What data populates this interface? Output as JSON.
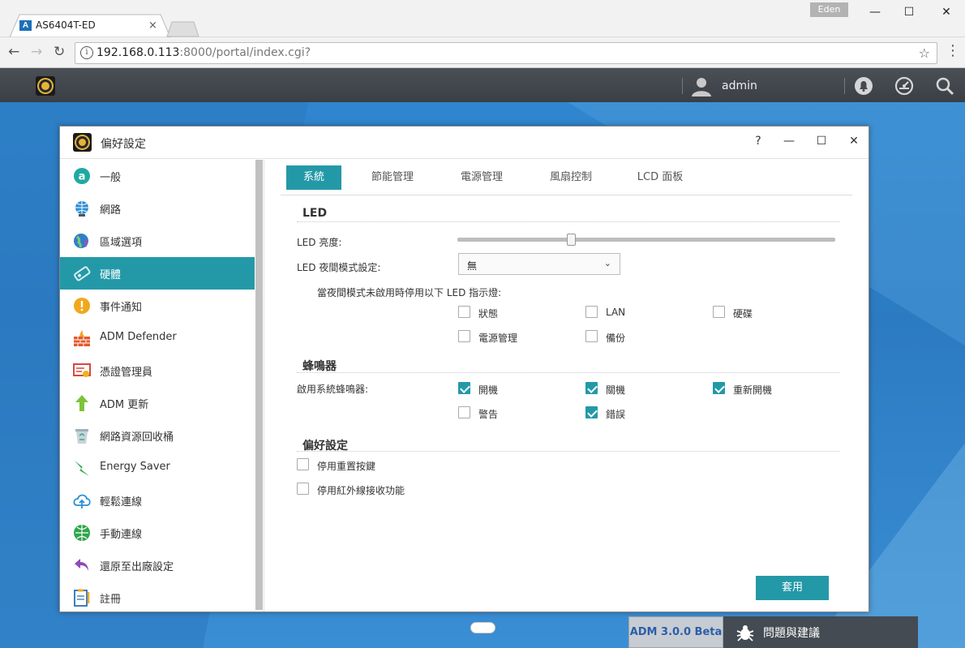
{
  "browser": {
    "tab_title": "AS6404T-ED",
    "tab_favicon": "A",
    "tab_close": "×",
    "profile_name": "Eden",
    "url_host": "192.168.0.113",
    "url_path": ":8000/portal/index.cgi?",
    "info_glyph": "i",
    "back_glyph": "←",
    "forward_glyph": "→",
    "reload_glyph": "↻",
    "star_glyph": "☆",
    "menu_glyph": "⋮",
    "minimize_glyph": "—",
    "maximize_glyph": "☐",
    "close_glyph": "✕"
  },
  "adm": {
    "username": "admin",
    "version": "ADM 3.0.0 Beta",
    "feedback_label": "問題與建議"
  },
  "dialog": {
    "title": "偏好設定",
    "help_glyph": "?",
    "minimize_glyph": "—",
    "maximize_glyph": "☐",
    "close_glyph": "✕"
  },
  "sidebar": {
    "items": [
      {
        "label": "一般",
        "icon": "general-icon"
      },
      {
        "label": "網路",
        "icon": "network-icon"
      },
      {
        "label": "區域選項",
        "icon": "region-icon"
      },
      {
        "label": "硬體",
        "icon": "hardware-icon",
        "active": true
      },
      {
        "label": "事件通知",
        "icon": "notification-icon"
      },
      {
        "label": "ADM Defender",
        "icon": "defender-icon"
      },
      {
        "label": "憑證管理員",
        "icon": "certificate-icon"
      },
      {
        "label": "ADM 更新",
        "icon": "update-icon"
      },
      {
        "label": "網路資源回收桶",
        "icon": "recycle-bin-icon"
      },
      {
        "label": "Energy Saver",
        "icon": "energy-saver-icon"
      },
      {
        "label": "輕鬆連線",
        "icon": "ezconnect-icon"
      },
      {
        "label": "手動連線",
        "icon": "manual-connect-icon"
      },
      {
        "label": "還原至出廠設定",
        "icon": "factory-reset-icon"
      },
      {
        "label": "註冊",
        "icon": "registration-icon"
      }
    ]
  },
  "tabs": [
    {
      "label": "系統",
      "active": true
    },
    {
      "label": "節能管理"
    },
    {
      "label": "電源管理"
    },
    {
      "label": "風扇控制"
    },
    {
      "label": "LCD 面板"
    }
  ],
  "led": {
    "section_title": "LED",
    "brightness_label": "LED 亮度:",
    "brightness_fraction": 0.3,
    "night_mode_label": "LED 夜間模式設定:",
    "night_mode_value": "無",
    "caret_glyph": "⌄",
    "disable_label": "當夜間模式未啟用時停用以下 LED 指示燈:",
    "options": [
      {
        "label": "狀態",
        "checked": false
      },
      {
        "label": "LAN",
        "checked": false
      },
      {
        "label": "硬碟",
        "checked": false
      },
      {
        "label": "電源管理",
        "checked": false
      },
      {
        "label": "備份",
        "checked": false
      }
    ]
  },
  "buzzer": {
    "section_title": "蜂鳴器",
    "enable_label": "啟用系統蜂鳴器:",
    "options": [
      {
        "label": "開機",
        "checked": true
      },
      {
        "label": "關機",
        "checked": true
      },
      {
        "label": "重新開機",
        "checked": true
      },
      {
        "label": "警告",
        "checked": false
      },
      {
        "label": "錯誤",
        "checked": true
      }
    ]
  },
  "prefs": {
    "section_title": "偏好設定",
    "options": [
      {
        "label": "停用重置按鍵",
        "checked": false
      },
      {
        "label": "停用紅外線接收功能",
        "checked": false
      }
    ]
  },
  "apply_label": "套用",
  "colors": {
    "accent": "#2399a8",
    "desktop": "#2b7fc7",
    "adm_bar": "#434950"
  }
}
